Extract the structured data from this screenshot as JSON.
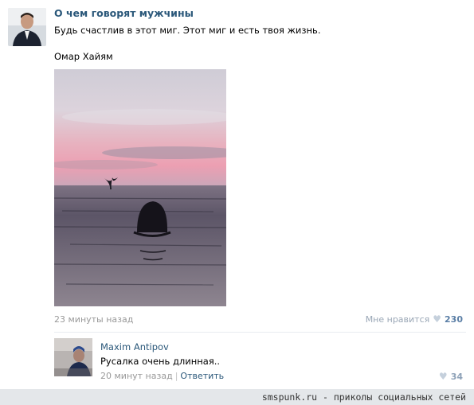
{
  "post": {
    "author": "О чем говорят мужчины",
    "text": "Будь счастлив в этот миг. Этот миг и есть твоя жизнь.",
    "signature": "Омар Хайям",
    "time": "23 минуты назад",
    "like_label": "Мне нравится",
    "like_count": "230"
  },
  "comment": {
    "author": "Maxim Antipov",
    "text": "Русалка очень длинная..",
    "time": "20 минут назад",
    "separator": "|",
    "reply_label": "Ответить",
    "like_count": "34"
  },
  "watermark": "smspunk.ru - приколы социальных сетей",
  "colors": {
    "link": "#2b587a",
    "meta": "#999999",
    "sky_top": "#d9d5de",
    "sky_pink": "#e8a9b6",
    "sea": "#3f3d4d"
  }
}
